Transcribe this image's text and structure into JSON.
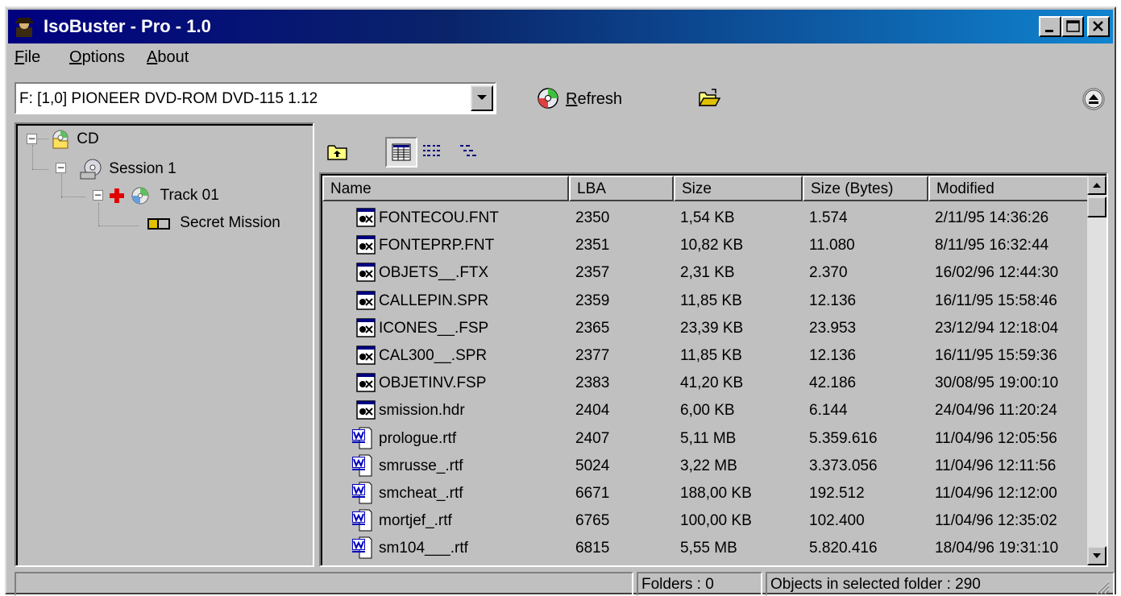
{
  "window": {
    "title": "IsoBuster - Pro - 1.0",
    "icon": "detective-icon"
  },
  "menu": [
    {
      "label": "File",
      "ul": "F",
      "rest": "ile"
    },
    {
      "label": "Options",
      "ul": "O",
      "rest": "ptions"
    },
    {
      "label": "About",
      "ul": "A",
      "rest": "bout"
    }
  ],
  "toolbar": {
    "drive": "F: [1,0] PIONEER  DVD-ROM DVD-115  1.12",
    "refresh_ul": "R",
    "refresh_rest": "efresh"
  },
  "tree": {
    "root": "CD",
    "session": "Session 1",
    "track": "Track 01",
    "volume": "Secret Mission"
  },
  "columns": [
    "Name",
    "LBA",
    "Size",
    "Size (Bytes)",
    "Modified"
  ],
  "files": [
    {
      "name": "FONTECOU.FNT",
      "lba": "2350",
      "size": "1,54 KB",
      "bytes": "1.574",
      "modified": "2/11/95 14:36:26",
      "icon": "executable-file-icon"
    },
    {
      "name": "FONTEPRP.FNT",
      "lba": "2351",
      "size": "10,82 KB",
      "bytes": "11.080",
      "modified": "8/11/95 16:32:44",
      "icon": "executable-file-icon"
    },
    {
      "name": "OBJETS__.FTX",
      "lba": "2357",
      "size": "2,31 KB",
      "bytes": "2.370",
      "modified": "16/02/96 12:44:30",
      "icon": "executable-file-icon"
    },
    {
      "name": "CALLEPIN.SPR",
      "lba": "2359",
      "size": "11,85 KB",
      "bytes": "12.136",
      "modified": "16/11/95 15:58:46",
      "icon": "executable-file-icon"
    },
    {
      "name": "ICONES__.FSP",
      "lba": "2365",
      "size": "23,39 KB",
      "bytes": "23.953",
      "modified": "23/12/94 12:18:04",
      "icon": "executable-file-icon"
    },
    {
      "name": "CAL300__.SPR",
      "lba": "2377",
      "size": "11,85 KB",
      "bytes": "12.136",
      "modified": "16/11/95 15:59:36",
      "icon": "executable-file-icon"
    },
    {
      "name": "OBJETINV.FSP",
      "lba": "2383",
      "size": "41,20 KB",
      "bytes": "42.186",
      "modified": "30/08/95 19:00:10",
      "icon": "executable-file-icon"
    },
    {
      "name": "smission.hdr",
      "lba": "2404",
      "size": "6,00 KB",
      "bytes": "6.144",
      "modified": "24/04/96 11:20:24",
      "icon": "executable-file-icon"
    },
    {
      "name": "prologue.rtf",
      "lba": "2407",
      "size": "5,11 MB",
      "bytes": "5.359.616",
      "modified": "11/04/96 12:05:56",
      "icon": "word-document-icon"
    },
    {
      "name": "smrusse_.rtf",
      "lba": "5024",
      "size": "3,22 MB",
      "bytes": "3.373.056",
      "modified": "11/04/96 12:11:56",
      "icon": "word-document-icon"
    },
    {
      "name": "smcheat_.rtf",
      "lba": "6671",
      "size": "188,00 KB",
      "bytes": "192.512",
      "modified": "11/04/96 12:12:00",
      "icon": "word-document-icon"
    },
    {
      "name": "mortjef_.rtf",
      "lba": "6765",
      "size": "100,00 KB",
      "bytes": "102.400",
      "modified": "11/04/96 12:35:02",
      "icon": "word-document-icon"
    },
    {
      "name": "sm104___.rtf",
      "lba": "6815",
      "size": "5,55 MB",
      "bytes": "5.820.416",
      "modified": "18/04/96 19:31:10",
      "icon": "word-document-icon"
    }
  ],
  "status": {
    "folders": "Folders : 0",
    "objects": "Objects in selected folder : 290"
  },
  "colors": {
    "title_start": "#000080",
    "title_end": "#1084d0",
    "face": "#c0c0c0"
  }
}
